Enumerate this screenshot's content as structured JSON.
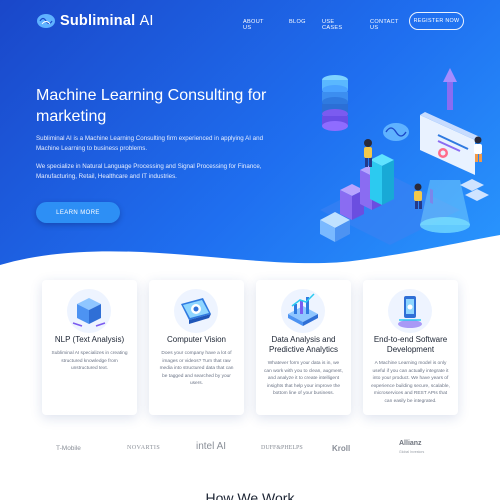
{
  "brand": {
    "name": "Subliminal",
    "suffix": "AI"
  },
  "nav": {
    "items": [
      "ABOUT US",
      "BLOG",
      "USE CASES",
      "CONTACT US"
    ],
    "register_label": "REGISTER NOW"
  },
  "hero": {
    "title": "Machine Learning Consulting for marketing",
    "paragraph1": "Subliminal AI is a Machine Learning Consulting firm experienced in applying AI and Machine Learning to business problems.",
    "paragraph2": "We specialize in Natural Language Processing and Signal Processing for Finance, Manufacturing, Retail, Healthcare and IT industries.",
    "cta_label": "LEARN MORE"
  },
  "services": [
    {
      "title": "NLP (Text Analysis)",
      "text": "Subliminal AI specializes in creating structured knowledge from unstructured text.",
      "icon": "nlp-cube-icon"
    },
    {
      "title": "Computer Vision",
      "text": "Does your company have a lot of images or videos? Turn that raw media into structured data that can be tagged and searched by your users.",
      "icon": "computer-vision-icon"
    },
    {
      "title": "Data Analysis and Predictive Analytics",
      "text": "Whatever form your data is in, we can work with you to clean, augment, and analyze it to create intelligent insights that help your improve the bottom line of your business.",
      "icon": "data-analysis-icon"
    },
    {
      "title": "End-to-end Software Development",
      "text": "A Machine Learning model is only useful if you can actually integrate it into your product. We have years of experience building secure, scalable, microservices and REST APIs that can easily be integrated.",
      "icon": "software-dev-icon"
    }
  ],
  "clients": [
    "T-Mobile",
    "NOVARTIS",
    "intel AI",
    "DUFF&PHELPS",
    "Kroll",
    "Allianz"
  ],
  "clients_sub": "Global Investors",
  "how_title": "How We Work",
  "colors": {
    "hero_start": "#1a47c9",
    "hero_end": "#2a9bff",
    "accent": "#2d8ff5"
  }
}
